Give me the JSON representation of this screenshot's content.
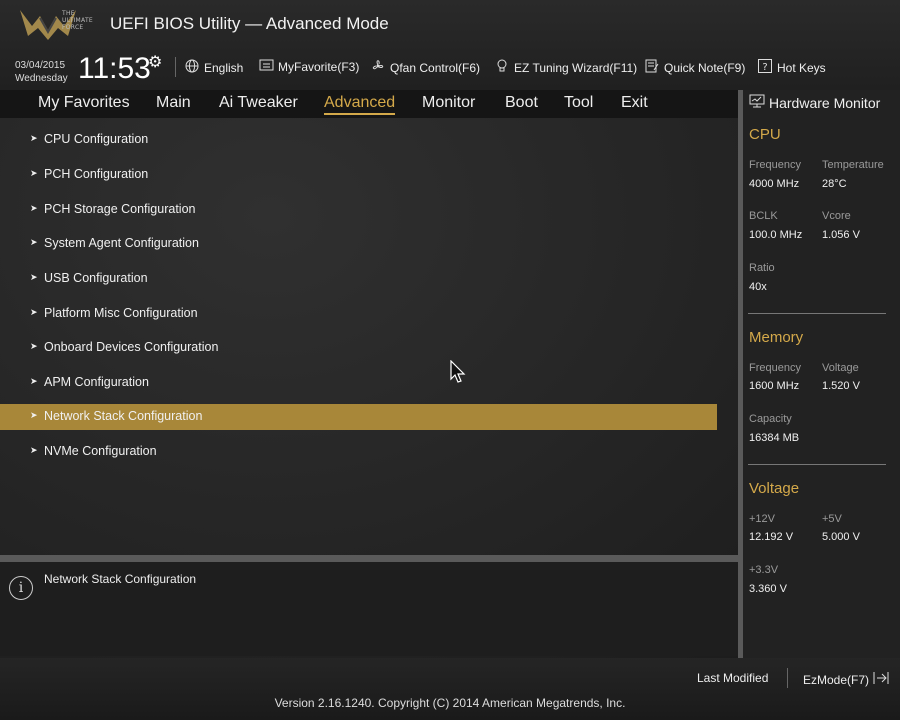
{
  "header": {
    "logo_text": "THE ULTIMATE FORCE",
    "title": "UEFI BIOS Utility — Advanced Mode",
    "date": "03/04/2015",
    "weekday": "Wednesday",
    "time": "11:53",
    "tools": [
      {
        "label": "English",
        "icon": "globe-icon"
      },
      {
        "label": "MyFavorite(F3)",
        "icon": "favorite-icon"
      },
      {
        "label": "Qfan Control(F6)",
        "icon": "fan-icon"
      },
      {
        "label": "EZ Tuning Wizard(F11)",
        "icon": "lightbulb-icon"
      },
      {
        "label": "Quick Note(F9)",
        "icon": "note-icon"
      },
      {
        "label": "Hot Keys",
        "icon": "help-icon"
      }
    ]
  },
  "nav": {
    "tabs": [
      {
        "label": "My Favorites"
      },
      {
        "label": "Main"
      },
      {
        "label": "Ai Tweaker"
      },
      {
        "label": "Advanced"
      },
      {
        "label": "Monitor"
      },
      {
        "label": "Boot"
      },
      {
        "label": "Tool"
      },
      {
        "label": "Exit"
      }
    ],
    "active": "Advanced"
  },
  "menu": {
    "items": [
      {
        "label": "CPU Configuration"
      },
      {
        "label": "PCH Configuration"
      },
      {
        "label": "PCH Storage Configuration"
      },
      {
        "label": "System Agent Configuration"
      },
      {
        "label": "USB Configuration"
      },
      {
        "label": "Platform Misc Configuration"
      },
      {
        "label": "Onboard Devices Configuration"
      },
      {
        "label": "APM Configuration"
      },
      {
        "label": "Network Stack Configuration"
      },
      {
        "label": "NVMe Configuration"
      }
    ],
    "selected": "Network Stack Configuration"
  },
  "info": {
    "text": "Network Stack Configuration"
  },
  "hardware_monitor": {
    "title": "Hardware Monitor",
    "cpu": {
      "heading": "CPU",
      "frequency_label": "Frequency",
      "frequency": "4000 MHz",
      "temperature_label": "Temperature",
      "temperature": "28°C",
      "bclk_label": "BCLK",
      "bclk": "100.0 MHz",
      "vcore_label": "Vcore",
      "vcore": "1.056 V",
      "ratio_label": "Ratio",
      "ratio": "40x"
    },
    "memory": {
      "heading": "Memory",
      "frequency_label": "Frequency",
      "frequency": "1600 MHz",
      "voltage_label": "Voltage",
      "voltage": "1.520 V",
      "capacity_label": "Capacity",
      "capacity": "16384 MB"
    },
    "voltage": {
      "heading": "Voltage",
      "v12_label": "+12V",
      "v12": "12.192 V",
      "v5_label": "+5V",
      "v5": "5.000 V",
      "v33_label": "+3.3V",
      "v33": "3.360 V"
    }
  },
  "footer": {
    "last_modified": "Last Modified",
    "ezmode": "EzMode(F7)",
    "version": "Version 2.16.1240. Copyright (C) 2014 American Megatrends, Inc."
  },
  "colors": {
    "accent": "#d4a94a",
    "selected_row": "#a88739"
  }
}
